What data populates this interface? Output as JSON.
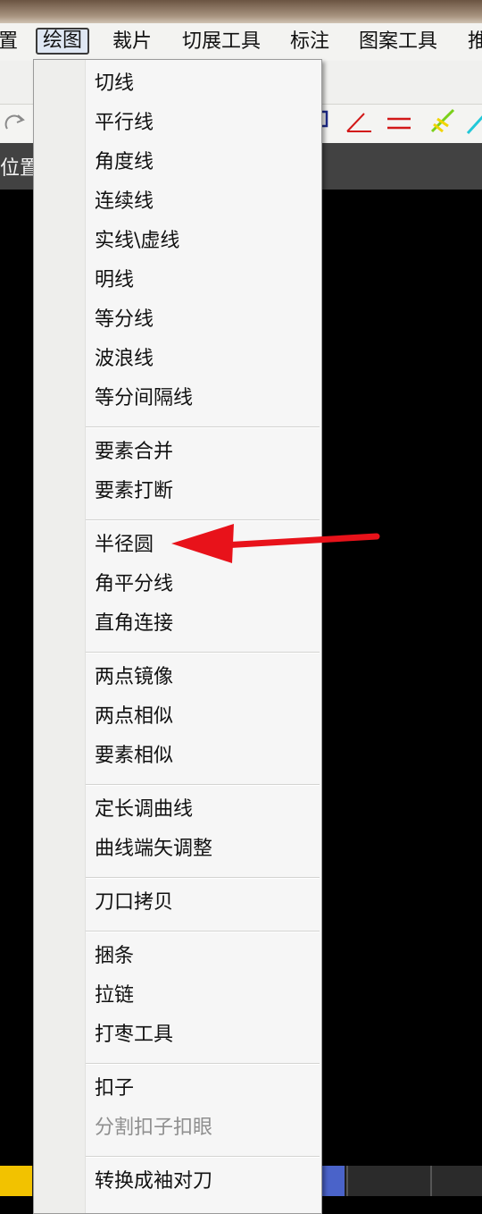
{
  "menubar": {
    "items": [
      {
        "label": "置"
      },
      {
        "label": "绘图",
        "active": true
      },
      {
        "label": "裁片"
      },
      {
        "label": "切展工具"
      },
      {
        "label": "标注"
      },
      {
        "label": "图案工具"
      },
      {
        "label": "推"
      }
    ]
  },
  "toolbar": {
    "icons": [
      "redo-icon",
      "curve-tool-icon",
      "angle-tool-icon",
      "parallel-line-icon",
      "yellow-green-tool-icon",
      "cyan-tool-icon"
    ]
  },
  "status": {
    "label": "位置"
  },
  "dropdown": {
    "groups": [
      {
        "items": [
          "切线",
          "平行线",
          "角度线",
          "连续线",
          "实线\\虚线",
          "明线",
          "等分线",
          "波浪线",
          "等分间隔线"
        ]
      },
      {
        "items": [
          "要素合并",
          "要素打断"
        ]
      },
      {
        "items": [
          "半径圆",
          "角平分线",
          "直角连接"
        ]
      },
      {
        "items": [
          "两点镜像",
          "两点相似",
          "要素相似"
        ]
      },
      {
        "items": [
          "定长调曲线",
          "曲线端矢调整"
        ]
      },
      {
        "items": [
          "刀口拷贝"
        ]
      },
      {
        "items": [
          "捆条",
          "拉链",
          "打枣工具"
        ]
      },
      {
        "items": [
          "扣子",
          "分割扣子扣眼"
        ],
        "disabled": [
          1
        ]
      },
      {
        "items": [
          "转换成袖对刀"
        ]
      }
    ]
  },
  "annotation": {
    "color": "#e8121a",
    "points_to": "半径圆"
  },
  "colors": {
    "menu_bg": "#f6f6f6",
    "canvas": "#000000",
    "toolbar_bg": "#f0f0ee",
    "bottom_swatch_yellow": "#f2c200",
    "bottom_swatch_blue": "#4a63c9"
  }
}
